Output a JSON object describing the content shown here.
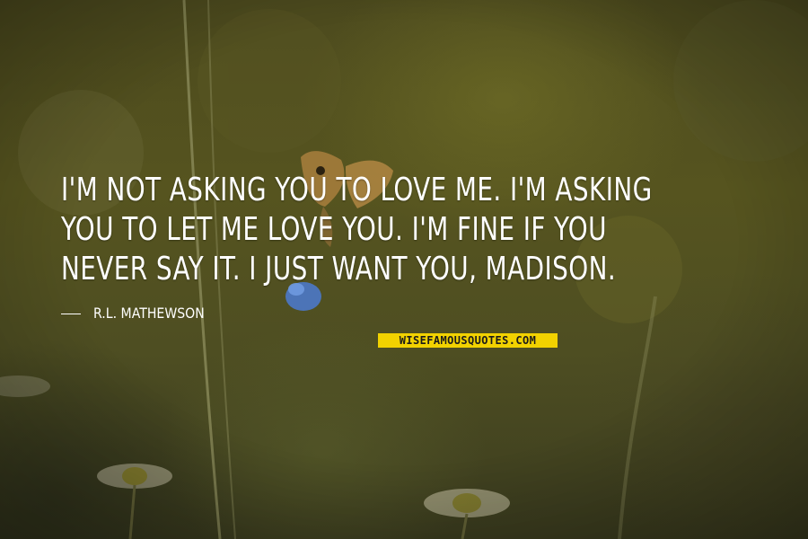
{
  "quote": {
    "text": "I'M NOT ASKING YOU TO LOVE ME. I'M ASKING YOU TO LET ME LOVE YOU. I'M FINE IF YOU NEVER SAY IT. I JUST WANT YOU, MADISON.",
    "author": "R.L. MATHEWSON"
  },
  "watermark": {
    "text": "WISEFAMOUSQUOTES.COM"
  },
  "colors": {
    "text": "#ffffff",
    "brand_bg": "#f2d200",
    "brand_text": "#1b1b1b",
    "background": "#4e4e22"
  },
  "scene": [
    "butterfly",
    "grass-stems",
    "daisy-flowers",
    "bokeh-background"
  ]
}
